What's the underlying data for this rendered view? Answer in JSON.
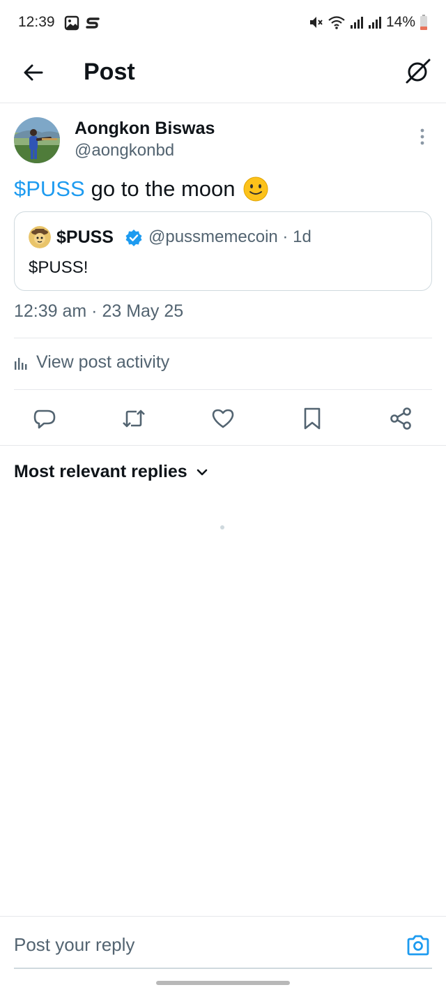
{
  "status_bar": {
    "time": "12:39",
    "battery": "14%",
    "icons": [
      "gallery-icon",
      "s-app-icon",
      "mute-icon",
      "wifi-icon",
      "signal-icon",
      "signal-icon",
      "battery-icon"
    ]
  },
  "header": {
    "title": "Post"
  },
  "post": {
    "author_name": "Aongkon Biswas",
    "author_handle": "@aongkonbd",
    "cashtag": "$PUSS",
    "text": "go to the moon",
    "emoji": "slightly-smiling-face",
    "quote": {
      "name": "$PUSS",
      "handle_meta": "@pussmemecoin · 1d",
      "text": "$PUSS!"
    },
    "timestamp": "12:39 am · 23 May 25"
  },
  "activity": {
    "label": "View post activity"
  },
  "actions": [
    "reply-icon",
    "repost-icon",
    "like-icon",
    "bookmark-icon",
    "share-icon"
  ],
  "replies": {
    "sort_label": "Most relevant replies"
  },
  "reply_bar": {
    "placeholder": "Post your reply"
  },
  "colors": {
    "accent": "#1d9bf0",
    "text": "#0f1419",
    "secondary": "#536471",
    "border": "#cfd9de"
  }
}
